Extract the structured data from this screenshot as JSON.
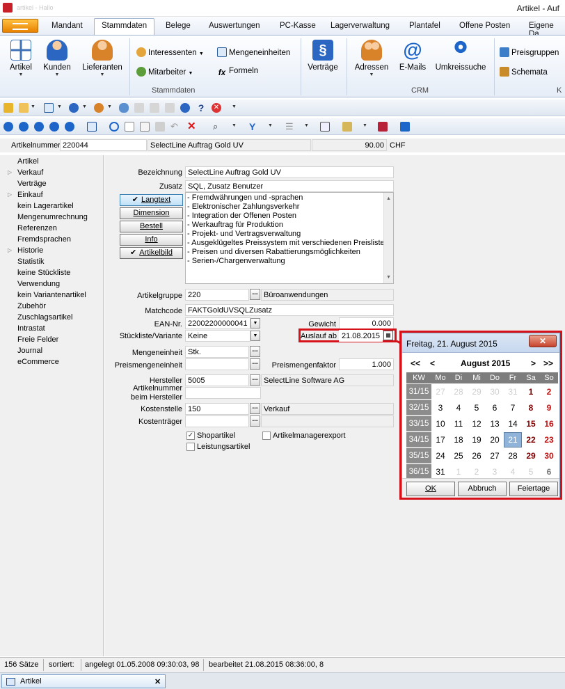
{
  "window": {
    "title": "Artikel - Auf",
    "faded_title": "artikel - Hallo"
  },
  "ribbon_tabs": [
    "Mandant",
    "Stammdaten",
    "Belege",
    "Auswertungen",
    "PC-Kasse",
    "Lagerverwaltung",
    "Plantafel",
    "Offene Posten",
    "Eigene Da"
  ],
  "ribbon": {
    "artikel": "Artikel",
    "kunden": "Kunden",
    "lieferanten": "Lieferanten",
    "interessenten": "Interessenten",
    "mitarbeiter": "Mitarbeiter",
    "mengeneinheiten": "Mengeneinheiten",
    "formeln": "Formeln",
    "vertraege": "Verträge",
    "adressen": "Adressen",
    "emails": "E-Mails",
    "umkreissuche": "Umkreissuche",
    "preisgruppen": "Preisgruppen",
    "schemata": "Schemata",
    "group_stammdaten": "Stammdaten",
    "group_crm": "CRM",
    "group_k": "K"
  },
  "header": {
    "artikelnummer_label": "Artikelnummer",
    "artikelnummer": "220044",
    "name": "SelectLine Auftrag Gold UV",
    "price": "90.00",
    "currency": "CHF"
  },
  "sidebar": {
    "head": "Artikel",
    "items": [
      "Verkauf",
      "Verträge",
      "Einkauf",
      "kein Lagerartikel",
      "Mengenumrechnung",
      "Referenzen",
      "Fremdsprachen",
      "Historie",
      "Statistik",
      "keine Stückliste",
      "Verwendung",
      "kein Variantenartikel",
      "Zubehör",
      "Zuschlagsartikel",
      "Intrastat",
      "Freie Felder",
      "Journal",
      "eCommerce"
    ]
  },
  "form": {
    "bezeichnung_label": "Bezeichnung",
    "bezeichnung": "SelectLine Auftrag Gold UV",
    "zusatz_label": "Zusatz",
    "zusatz": "SQL, Zusatz Benutzer",
    "buttons": {
      "langtext": "Langtext",
      "dimension": "Dimension",
      "bestell": "Bestell",
      "info": "Info",
      "artikelbild": "Artikelbild"
    },
    "memo_lines": [
      "- Fremdwährungen und -sprachen",
      "- Elektronischer Zahlungsverkehr",
      "- Integration der Offenen Posten",
      "- Werkauftrag für Produktion",
      "- Projekt- und Vertragsverwaltung",
      "- Ausgeklügeltes Preissystem mit verschiedenen Preislisten,",
      "- Preisen und diversen Rabattierungsmöglichkeiten",
      "- Serien-/Chargenverwaltung"
    ],
    "artikelgruppe_label": "Artikelgruppe",
    "artikelgruppe": "220",
    "artikelgruppe_name": "Büroanwendungen",
    "matchcode_label": "Matchcode",
    "matchcode": "FAKTGoldUVSQLZusatz",
    "ean_label": "EAN-Nr.",
    "ean": "22002200000041",
    "gewicht_label": "Gewicht",
    "gewicht": "0.000",
    "stueckliste_label": "Stückliste/Variante",
    "stueckliste": "Keine",
    "auslauf_label": "Auslauf ab",
    "auslauf": "21.08.2015",
    "mengeneinheit_label": "Mengeneinheit",
    "mengeneinheit": "Stk.",
    "preismengeneinheit_label": "Preismengeneinheit",
    "preismengeneinheit": "",
    "preismengenfaktor_label": "Preismengenfaktor",
    "preismengenfaktor": "1.000",
    "hersteller_label": "Hersteller",
    "hersteller": "5005",
    "hersteller_name": "SelectLine Software AG",
    "artikelnummer_hersteller_label1": "Artikelnummer",
    "artikelnummer_hersteller_label2": "beim Hersteller",
    "artikelnummer_hersteller": "",
    "kostenstelle_label": "Kostenstelle",
    "kostenstelle": "150",
    "kostenstelle_name": "Verkauf",
    "kostentraeger_label": "Kostenträger",
    "kostentraeger": "",
    "shopartikel": "Shopartikel",
    "artikelmanagerexport": "Artikelmanagerexport",
    "leistungsartikel": "Leistungsartikel"
  },
  "calendar": {
    "title": "Freitag, 21. August 2015",
    "prev": "<<",
    "prev1": "<",
    "next1": ">",
    "next": ">>",
    "month_label": "August 2015",
    "headers": [
      "KW",
      "Mo",
      "Di",
      "Mi",
      "Do",
      "Fr",
      "Sa",
      "So"
    ],
    "weeks": [
      {
        "kw": "31/15",
        "days": [
          "27",
          "28",
          "29",
          "30",
          "31",
          "1",
          "2"
        ]
      },
      {
        "kw": "32/15",
        "days": [
          "3",
          "4",
          "5",
          "6",
          "7",
          "8",
          "9"
        ]
      },
      {
        "kw": "33/15",
        "days": [
          "10",
          "11",
          "12",
          "13",
          "14",
          "15",
          "16"
        ]
      },
      {
        "kw": "34/15",
        "days": [
          "17",
          "18",
          "19",
          "20",
          "21",
          "22",
          "23"
        ]
      },
      {
        "kw": "35/15",
        "days": [
          "24",
          "25",
          "26",
          "27",
          "28",
          "29",
          "30"
        ]
      },
      {
        "kw": "36/15",
        "days": [
          "31",
          "1",
          "2",
          "3",
          "4",
          "5",
          "6"
        ]
      }
    ],
    "ok": "OK",
    "abbruch": "Abbruch",
    "feiertage": "Feiertage"
  },
  "status": {
    "count": "156 Sätze",
    "sortiert": "sortiert:",
    "angelegt": "angelegt 01.05.2008 09:30:03, 98",
    "bearbeitet": "bearbeitet 21.08.2015 08:36:00,  8"
  },
  "taskbar": {
    "tab": "Artikel",
    "close": "✕"
  },
  "colors": {
    "accent": "#1e65c9",
    "highlight": "#d6111a",
    "selected_day": "#8fb3d9"
  }
}
